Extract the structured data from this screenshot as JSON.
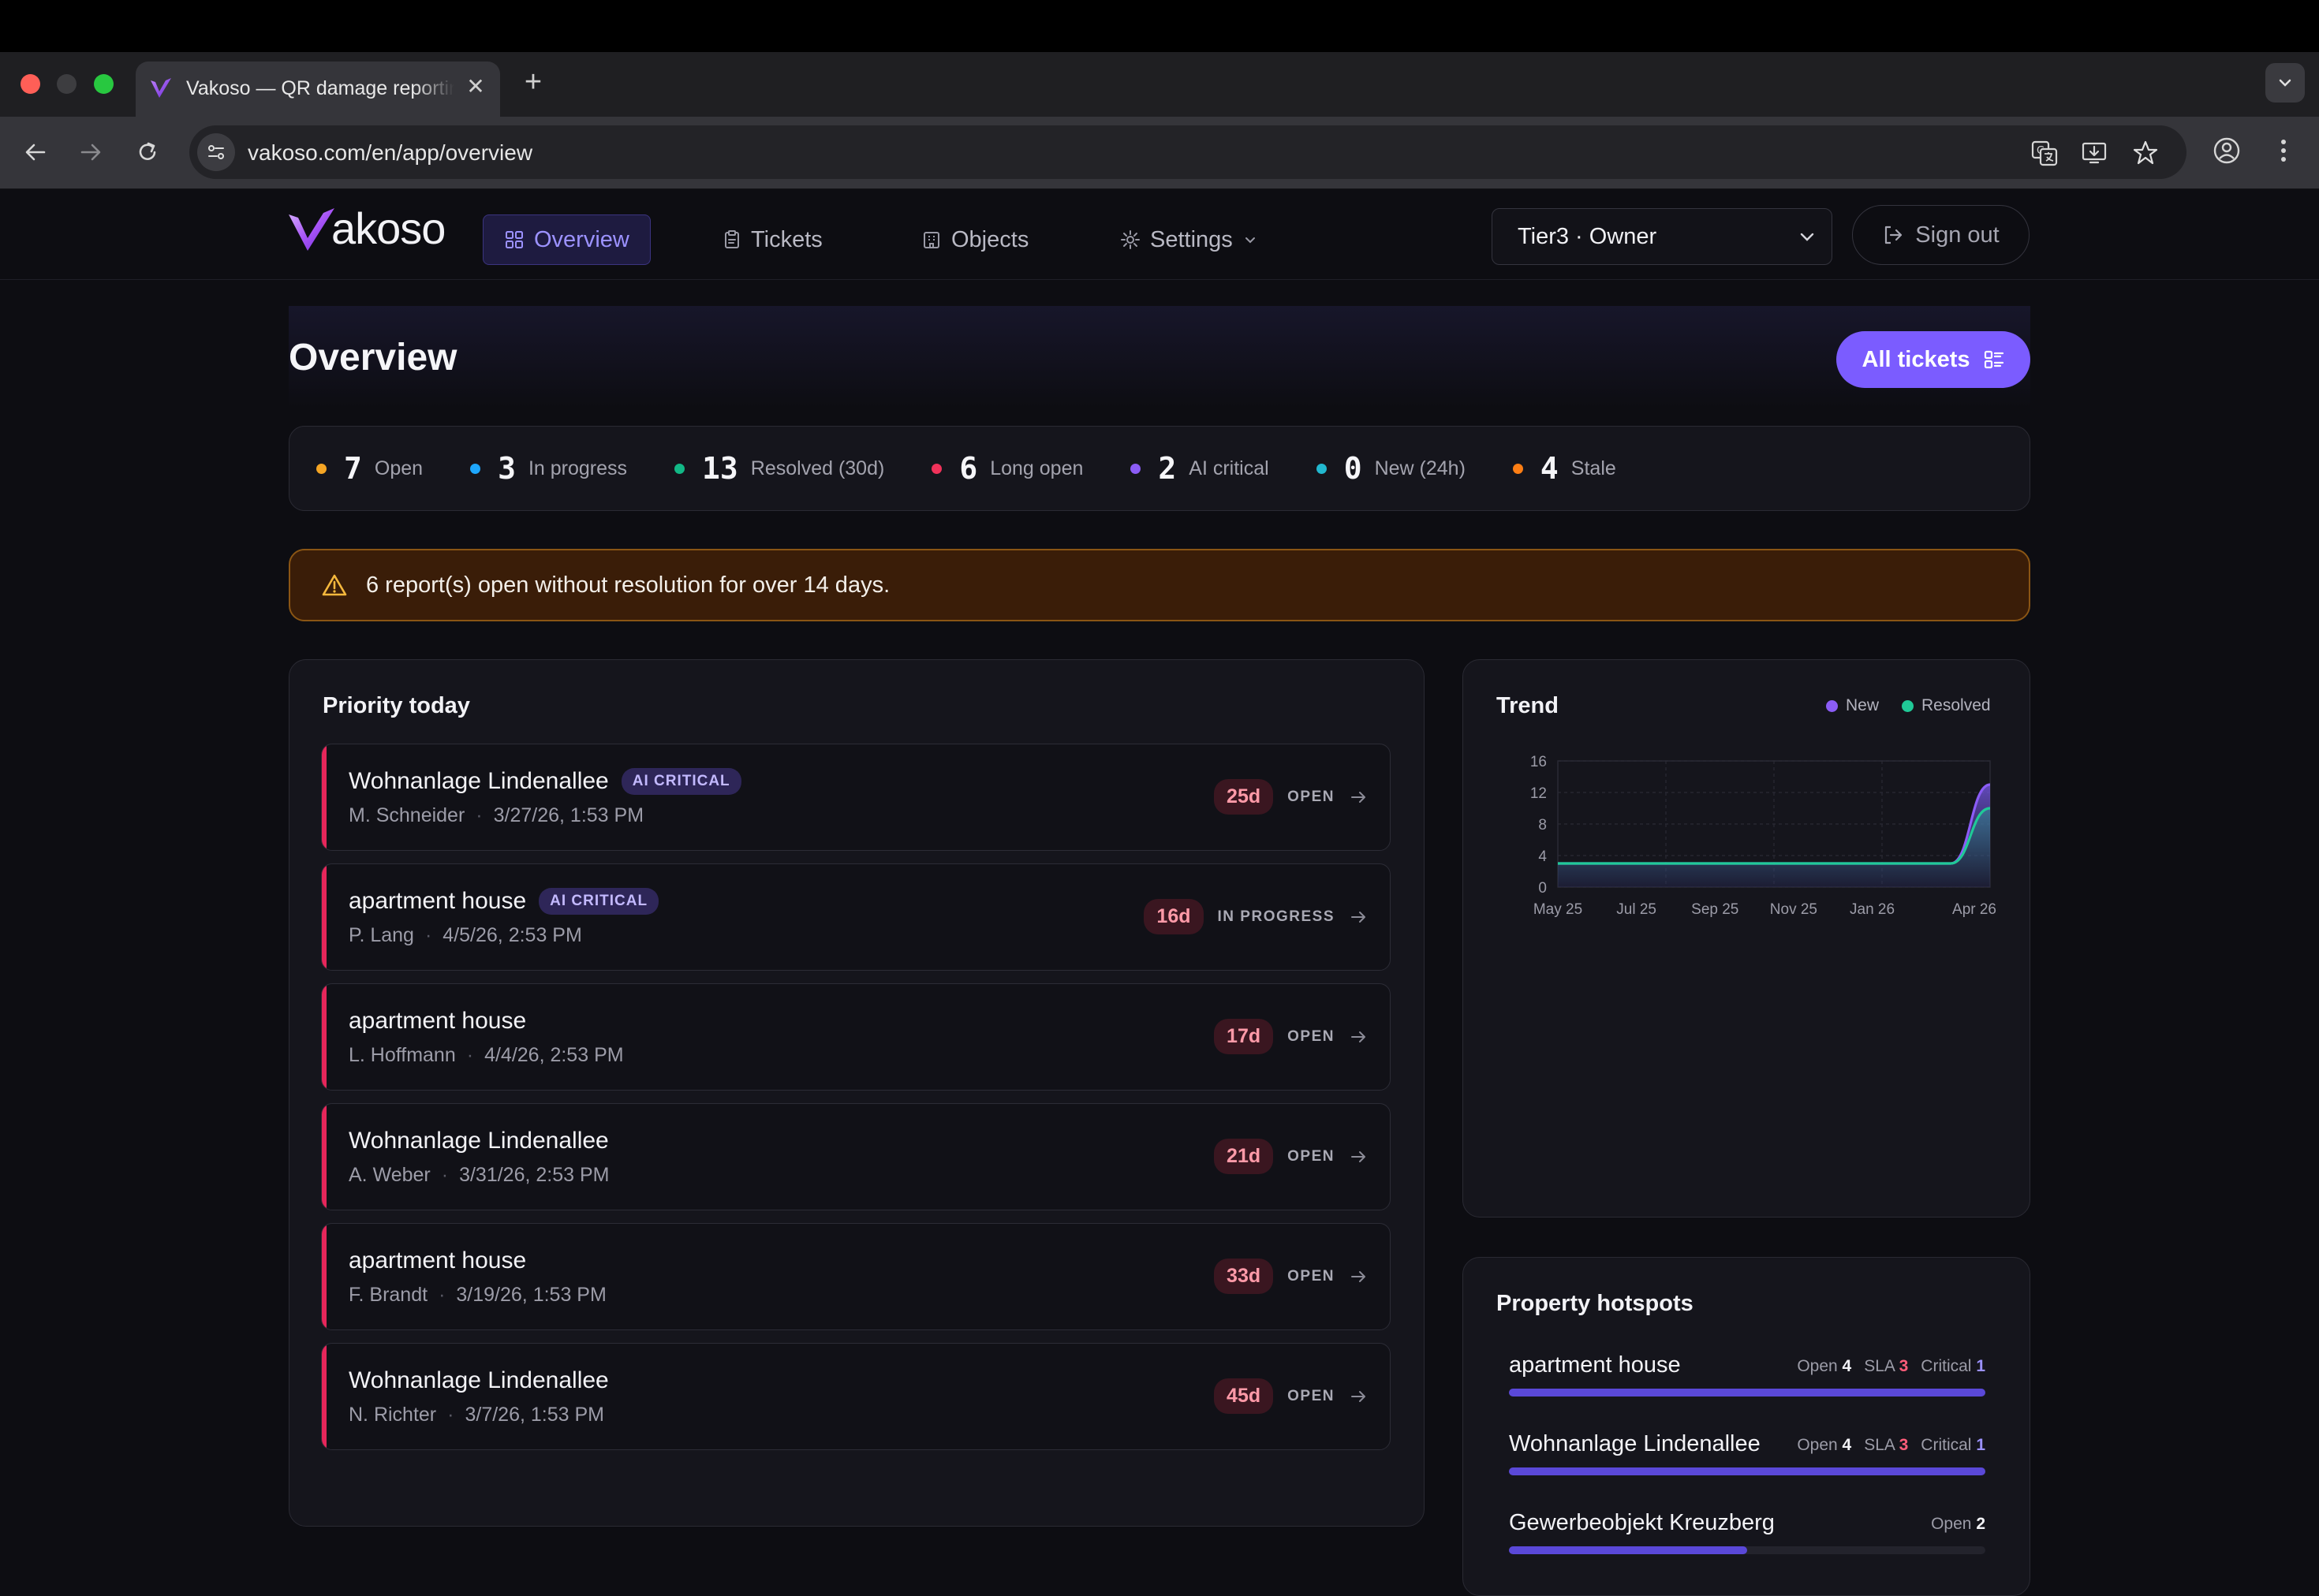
{
  "browser": {
    "tab_title": "Vakoso — QR damage reporting",
    "url": "vakoso.com/en/app/overview"
  },
  "nav": {
    "logo": "akoso",
    "items": [
      "Overview",
      "Tickets",
      "Objects",
      "Settings"
    ],
    "role": "Tier3 · Owner",
    "sign_out": "Sign out"
  },
  "page": {
    "title": "Overview",
    "all_tickets": "All tickets"
  },
  "stats": [
    {
      "value": "7",
      "label": "Open",
      "color": "#f5a524"
    },
    {
      "value": "3",
      "label": "In progress",
      "color": "#1ea7fd"
    },
    {
      "value": "13",
      "label": "Resolved (30d)",
      "color": "#12b886"
    },
    {
      "value": "6",
      "label": "Long open",
      "color": "#f0325a"
    },
    {
      "value": "2",
      "label": "AI critical",
      "color": "#8b5cf6"
    },
    {
      "value": "0",
      "label": "New (24h)",
      "color": "#22b8cf"
    },
    {
      "value": "4",
      "label": "Stale",
      "color": "#fd7e14"
    }
  ],
  "alert": {
    "text": "6 report(s) open without resolution for over 14 days."
  },
  "priority": {
    "title": "Priority today",
    "rows": [
      {
        "name": "Wohnanlage Lindenallee",
        "badge": "AI CRITICAL",
        "person": "M. Schneider",
        "date": "3/27/26, 1:53 PM",
        "age": "25d",
        "status": "OPEN"
      },
      {
        "name": "apartment house",
        "badge": "AI CRITICAL",
        "person": "P. Lang",
        "date": "4/5/26, 2:53 PM",
        "age": "16d",
        "status": "IN PROGRESS"
      },
      {
        "name": "apartment house",
        "badge": "",
        "person": "L. Hoffmann",
        "date": "4/4/26, 2:53 PM",
        "age": "17d",
        "status": "OPEN"
      },
      {
        "name": "Wohnanlage Lindenallee",
        "badge": "",
        "person": "A. Weber",
        "date": "3/31/26, 2:53 PM",
        "age": "21d",
        "status": "OPEN"
      },
      {
        "name": "apartment house",
        "badge": "",
        "person": "F. Brandt",
        "date": "3/19/26, 1:53 PM",
        "age": "33d",
        "status": "OPEN"
      },
      {
        "name": "Wohnanlage Lindenallee",
        "badge": "",
        "person": "N. Richter",
        "date": "3/7/26, 1:53 PM",
        "age": "45d",
        "status": "OPEN"
      }
    ]
  },
  "trend": {
    "title": "Trend",
    "legend": {
      "new": "New",
      "resolved": "Resolved"
    },
    "colors": {
      "new": "#8b5cf6",
      "resolved": "#20c997"
    }
  },
  "chart_data": {
    "type": "area",
    "title": "Trend",
    "x": [
      "May 25",
      "Jun 25",
      "Jul 25",
      "Aug 25",
      "Sep 25",
      "Oct 25",
      "Nov 25",
      "Dec 25",
      "Jan 26",
      "Feb 26",
      "Mar 26",
      "Apr 26"
    ],
    "x_tick_labels": [
      "May 25",
      "Jul 25",
      "Sep 25",
      "Nov 25",
      "Jan 26",
      "Apr 26"
    ],
    "series": [
      {
        "name": "New",
        "values": [
          3,
          3,
          3,
          3,
          3,
          3,
          3,
          3,
          3,
          3,
          3,
          13
        ]
      },
      {
        "name": "Resolved",
        "values": [
          3,
          3,
          3,
          3,
          3,
          3,
          3,
          3,
          3,
          3,
          3,
          10
        ]
      }
    ],
    "y_ticks": [
      0,
      4,
      8,
      12,
      16
    ],
    "ylim": [
      0,
      16
    ],
    "grid": true,
    "legend": "top-right"
  },
  "hotspots": {
    "title": "Property hotspots",
    "open_label": "Open",
    "sla_label": "SLA",
    "critical_label": "Critical",
    "items": [
      {
        "name": "apartment house",
        "open": "4",
        "sla": "3",
        "critical": "1",
        "share": 1.0
      },
      {
        "name": "Wohnanlage Lindenallee",
        "open": "4",
        "sla": "3",
        "critical": "1",
        "share": 1.0
      },
      {
        "name": "Gewerbeobjekt Kreuzberg",
        "open": "2",
        "sla": "",
        "critical": "",
        "share": 0.5
      }
    ]
  }
}
